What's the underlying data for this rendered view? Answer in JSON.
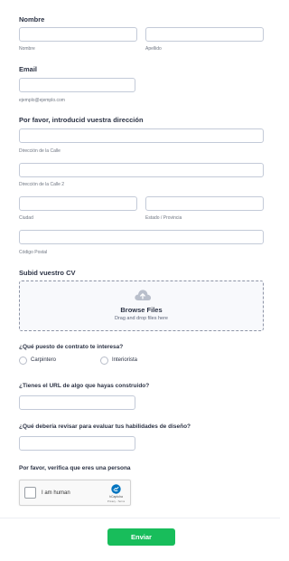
{
  "form": {
    "name": {
      "label": "Nombre",
      "first_sub": "Nombre",
      "last_sub": "Apellido"
    },
    "email": {
      "label": "Email",
      "sub": "ejemplo@ejemplo.com"
    },
    "address": {
      "label": "Por favor, introducid vuestra dirección",
      "street1_sub": "Dirección de la Calle",
      "street2_sub": "Dirección de la Calle 2",
      "city_sub": "Ciudad",
      "state_sub": "Estado / Provincia",
      "postal_sub": "Código Postal"
    },
    "cv": {
      "label": "Subid vuestro CV",
      "browse": "Browse Files",
      "drag": "Drag and drop files here"
    },
    "position": {
      "label": "¿Qué puesto de contrato te interesa?",
      "options": [
        "Carpintero",
        "Interiorista"
      ]
    },
    "url_question": {
      "label": "¿Tienes el URL de algo que hayas construido?"
    },
    "design_question": {
      "label": "¿Qué debería revisar para evaluar tus habilidades de diseño?"
    },
    "verify": {
      "label": "Por favor, verifica que eres una persona"
    },
    "captcha": {
      "text": "I am human",
      "brand": "hCaptcha",
      "links": "Privacy - Terms"
    },
    "submit_label": "Enviar"
  },
  "colors": {
    "accent": "#18bd5b",
    "text": "#2c3345",
    "border": "#c3cad8",
    "hcaptcha": "#0074bf"
  }
}
